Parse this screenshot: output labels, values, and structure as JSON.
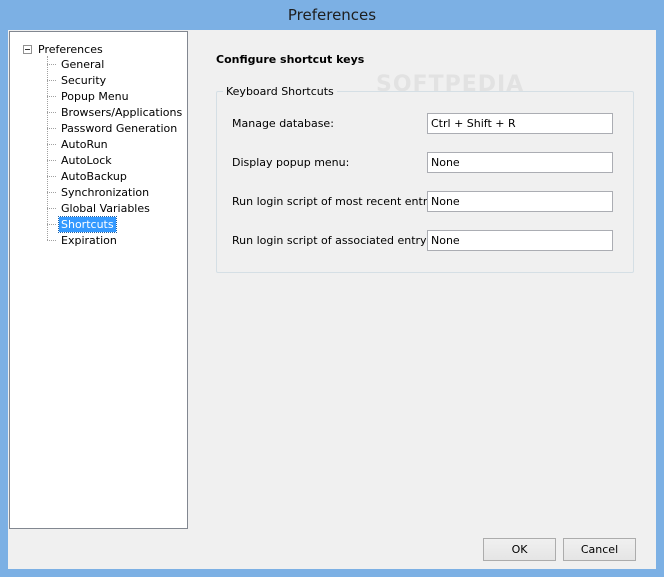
{
  "window": {
    "title": "Preferences"
  },
  "tree": {
    "root_label": "Preferences",
    "items": [
      {
        "label": "General",
        "selected": false
      },
      {
        "label": "Security",
        "selected": false
      },
      {
        "label": "Popup Menu",
        "selected": false
      },
      {
        "label": "Browsers/Applications",
        "selected": false
      },
      {
        "label": "Password Generation",
        "selected": false
      },
      {
        "label": "AutoRun",
        "selected": false
      },
      {
        "label": "AutoLock",
        "selected": false
      },
      {
        "label": "AutoBackup",
        "selected": false
      },
      {
        "label": "Synchronization",
        "selected": false
      },
      {
        "label": "Global Variables",
        "selected": false
      },
      {
        "label": "Shortcuts",
        "selected": true
      },
      {
        "label": "Expiration",
        "selected": false
      }
    ]
  },
  "panel": {
    "title": "Configure shortcut keys",
    "group_label": "Keyboard Shortcuts",
    "rows": [
      {
        "label": "Manage database:",
        "value": "Ctrl + Shift + R"
      },
      {
        "label": "Display popup menu:",
        "value": "None"
      },
      {
        "label": "Run login script of most recent entry:",
        "value": "None"
      },
      {
        "label": "Run login script of associated entry:",
        "value": "None"
      }
    ]
  },
  "buttons": {
    "ok_label": "OK",
    "cancel_label": "Cancel"
  },
  "watermark": "SOFTPEDIA"
}
